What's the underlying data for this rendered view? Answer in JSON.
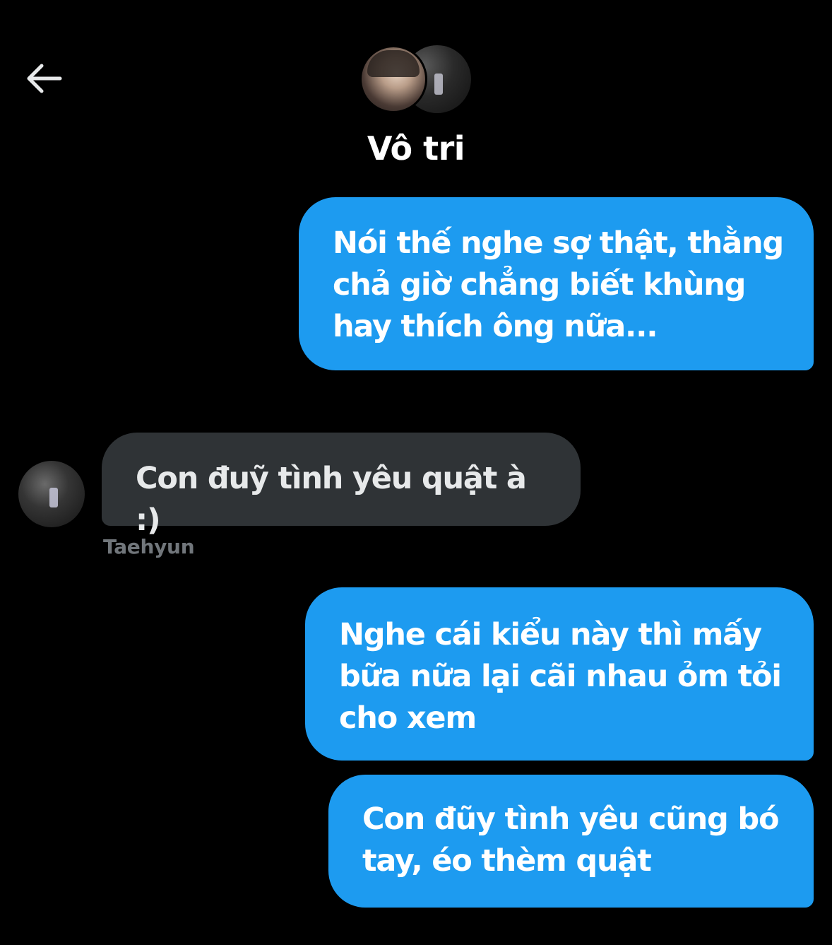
{
  "header": {
    "back_icon": "arrow-left-icon",
    "title": "Vô tri",
    "group_avatar_icons": [
      "avatar-photo",
      "avatar-photo"
    ]
  },
  "messages": [
    {
      "direction": "sent",
      "text": "Nói thế nghe sợ thật, thằng\nchả giờ chẳng biết khùng\nhay thích ông nữa..."
    },
    {
      "direction": "received",
      "sender": "Taehyun",
      "text": "Con đuỹ tình yêu quật à :)"
    },
    {
      "direction": "sent",
      "text": "Nghe cái kiểu này thì mấy\nbữa nữa lại cãi nhau ỏm tỏi\ncho xem"
    },
    {
      "direction": "sent",
      "text": "Con đũy tình yêu cũng bó\ntay, éo thèm quật"
    }
  ],
  "colors": {
    "background": "#000000",
    "sent_bubble": "#1d9bf0",
    "received_bubble": "#2f3336",
    "muted_text": "#71767b"
  }
}
